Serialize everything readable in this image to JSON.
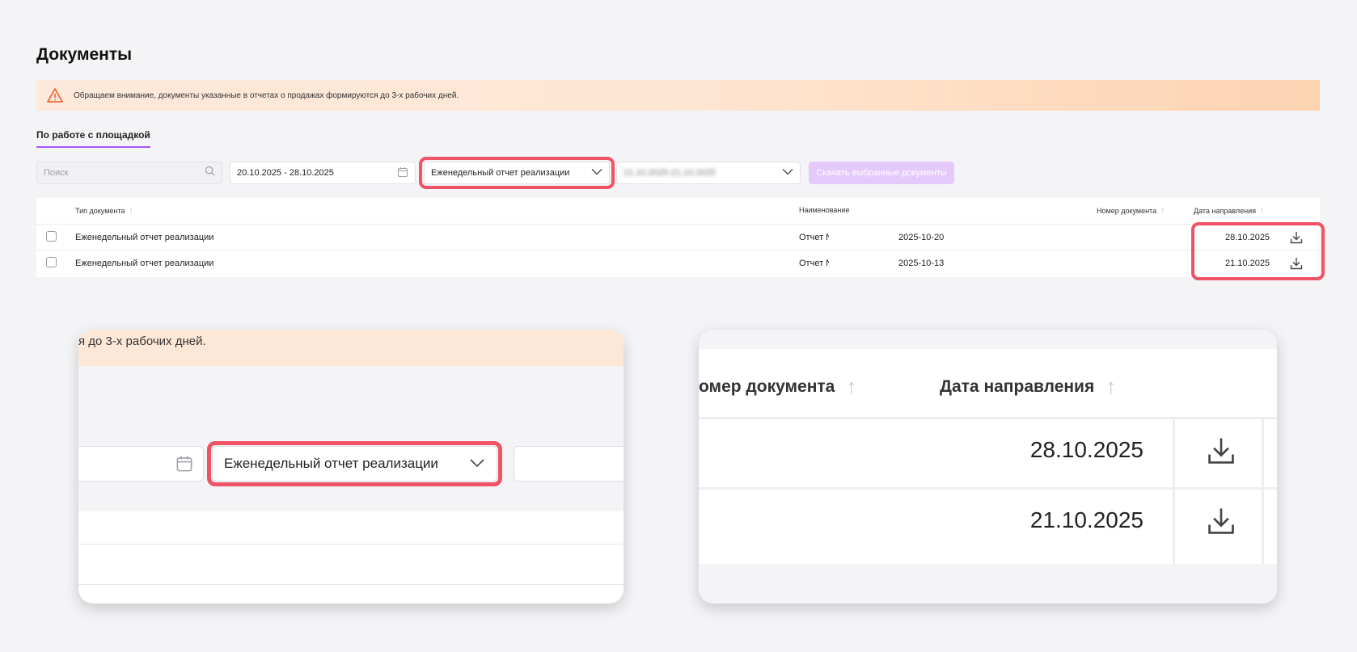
{
  "page": {
    "title": "Документы",
    "notice": "Обращаем внимание, документы указанные в отчетах о продажах формируются до 3-х рабочих дней.",
    "tab": "По работе с площадкой"
  },
  "filters": {
    "search_placeholder": "Поиск",
    "date_range": "20.10.2025 - 28.10.2025",
    "document_type": "Еженедельный отчет реализации",
    "period": "21.10.2025-21.10.2025",
    "download_selected": "Скачать выбранные документы"
  },
  "table": {
    "headers": {
      "type": "Тип документа",
      "name": "Наименование",
      "number": "Номер документа",
      "date": "Дата направления"
    },
    "rows": [
      {
        "type": "Еженедельный отчет реализации",
        "name_start": "Отчет N",
        "name_end": "2025-10-20",
        "date": "28.10.2025"
      },
      {
        "type": "Еженедельный отчет реализации",
        "name_start": "Отчет N",
        "name_end": "2025-10-13",
        "date": "21.10.2025"
      }
    ]
  },
  "zoom_left": {
    "notice_fragment": "я до 3-х рабочих дней.",
    "document_type": "Еженедельный отчет реализации"
  },
  "zoom_right": {
    "header_number_fragment": "омер документа",
    "header_date": "Дата направления",
    "dates": [
      "28.10.2025",
      "21.10.2025"
    ]
  },
  "colors": {
    "accent": "#a855f7",
    "highlight": "#ef5466",
    "button_disabled": "#e5c9fb",
    "warning": "#f26d3d"
  },
  "icons": [
    "warning-icon",
    "search-icon",
    "calendar-icon",
    "chevron-down-icon",
    "download-icon",
    "sort-arrow-icon"
  ]
}
